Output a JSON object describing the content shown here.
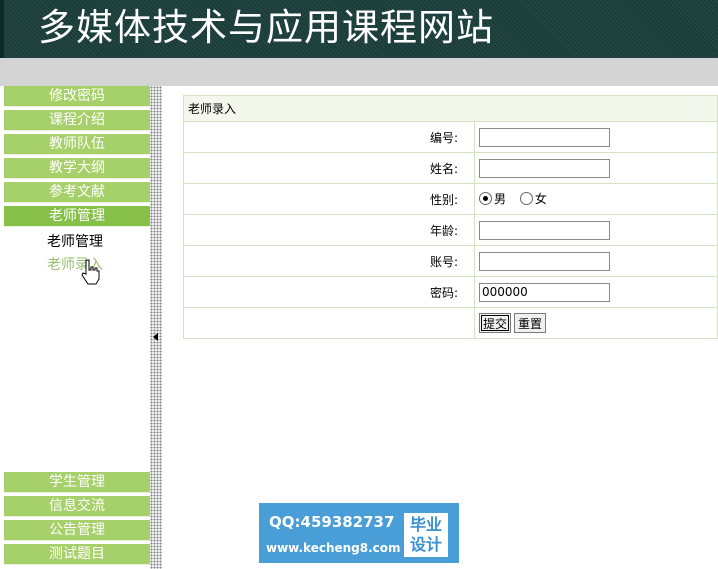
{
  "header": {
    "title": "多媒体技术与应用课程网站"
  },
  "sidebar": {
    "top_menu": [
      "修改密码",
      "课程介绍",
      "教师队伍",
      "教学大纲",
      "参考文献",
      "老师管理"
    ],
    "submenu": [
      "老师管理",
      "老师录入"
    ],
    "bottom_menu": [
      "学生管理",
      "信息交流",
      "公告管理",
      "测试题目"
    ]
  },
  "form": {
    "title": "老师录入",
    "fields": {
      "number": {
        "label": "编号:",
        "value": ""
      },
      "name": {
        "label": "姓名:",
        "value": ""
      },
      "gender": {
        "label": "性别:",
        "options": [
          "男",
          "女"
        ],
        "selected": "男"
      },
      "age": {
        "label": "年龄:",
        "value": ""
      },
      "account": {
        "label": "账号:",
        "value": ""
      },
      "password": {
        "label": "密码:",
        "value": "000000"
      }
    },
    "submit_label": "提交",
    "reset_label": "重置"
  },
  "watermark": {
    "qq": "QQ:459382737",
    "url": "www.kecheng8.com",
    "badge_line1": "毕业",
    "badge_line2": "设计"
  },
  "colors": {
    "header_bg": "#1a3d3a",
    "menu_green": "#a6d06a",
    "menu_active": "#86c048",
    "watermark_blue": "#4a9ed8"
  },
  "icons": {
    "collapse": "triangle-left-icon",
    "cursor": "hand-pointer-icon"
  }
}
